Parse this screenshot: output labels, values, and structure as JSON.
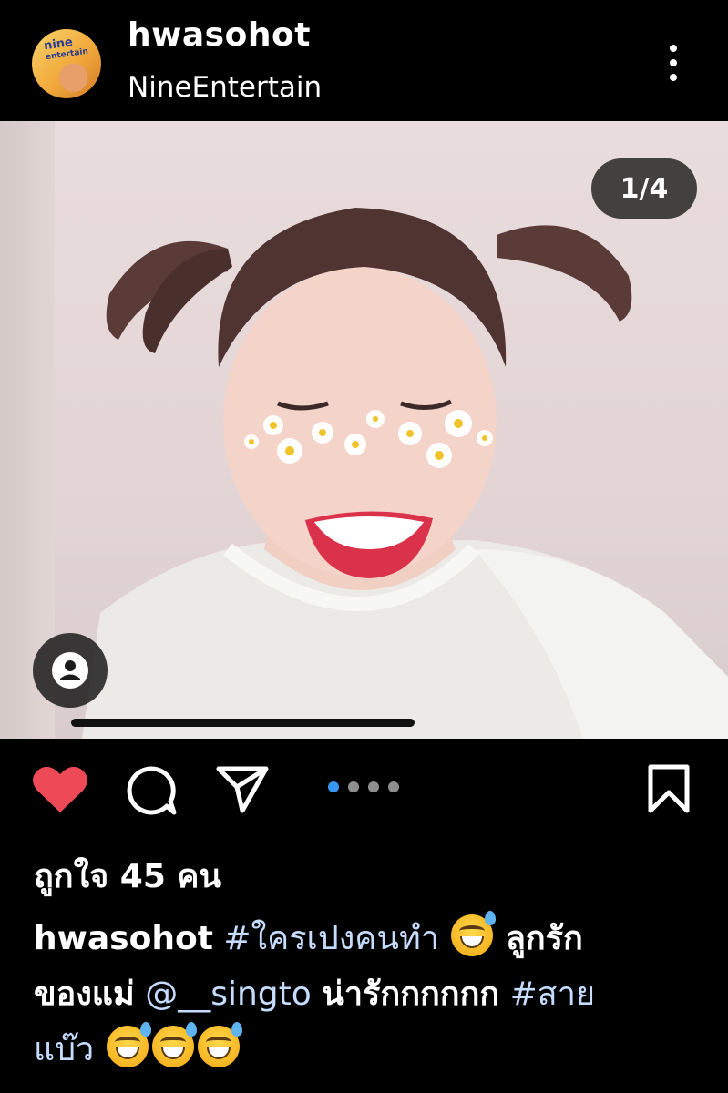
{
  "header": {
    "username": "hwasohot",
    "subtitle": "NineEntertain",
    "avatar_logo_line1": "nine",
    "avatar_logo_line2": "entertain"
  },
  "media": {
    "counter": "1/4",
    "current_slide": 1,
    "total_slides": 4,
    "progress": 0.5
  },
  "actions": {
    "liked": true,
    "like_color": "#ed4956",
    "active_dot_color": "#3897f0"
  },
  "likes_text": "ถูกใจ 45 คน",
  "caption": {
    "user": "hwasohot",
    "tag1": "#ใครเปงคนทำ",
    "text1": "ลูกรัก",
    "text2": "ของแม่",
    "mention": "@__singto",
    "text3": "น่ารักกกกกก",
    "tag2": "#สาย",
    "tag2_cont": "แบ๊ว"
  },
  "icons": [
    "more-vertical-icon",
    "person-tag-icon",
    "heart-icon",
    "comment-icon",
    "share-icon",
    "bookmark-icon",
    "grinning-sweat-emoji"
  ]
}
